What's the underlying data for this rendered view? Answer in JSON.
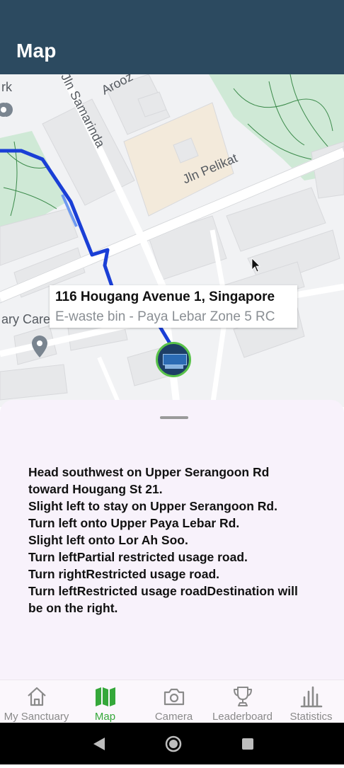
{
  "app_bar": {
    "title": "Map"
  },
  "map": {
    "street_labels": [
      "Jln Pelikat",
      "Jln Samarinda",
      "Arooz",
      "rk",
      "ary Care"
    ],
    "info_window": {
      "address": "116 Hougang Avenue 1, Singapore",
      "subtitle": "E-waste bin - Paya Lebar Zone 5 RC"
    },
    "route_color": "#1a3fd6",
    "marker_border_color": "#59c24a"
  },
  "directions": {
    "steps": [
      "Head southwest on Upper Serangoon Rd toward Hougang St 21.",
      "Slight left to stay on Upper Serangoon Rd.",
      "Turn left onto Upper Paya Lebar Rd.",
      "Slight left onto Lor Ah Soo.",
      "Turn leftPartial restricted usage road.",
      "Turn rightRestricted usage road.",
      "Turn leftRestricted usage roadDestination will be on the right."
    ]
  },
  "bottom_nav": {
    "items": [
      {
        "label": "My Sanctuary",
        "icon": "home-icon",
        "active": false
      },
      {
        "label": "Map",
        "icon": "map-icon",
        "active": true
      },
      {
        "label": "Camera",
        "icon": "camera-icon",
        "active": false
      },
      {
        "label": "Leaderboard",
        "icon": "trophy-icon",
        "active": false
      },
      {
        "label": "Statistics",
        "icon": "bar-chart-icon",
        "active": false
      }
    ],
    "active_color": "#35a83a",
    "inactive_color": "#8a8a8a"
  },
  "system_nav": {
    "buttons": [
      "back-icon",
      "home-circle-icon",
      "recents-icon"
    ]
  }
}
